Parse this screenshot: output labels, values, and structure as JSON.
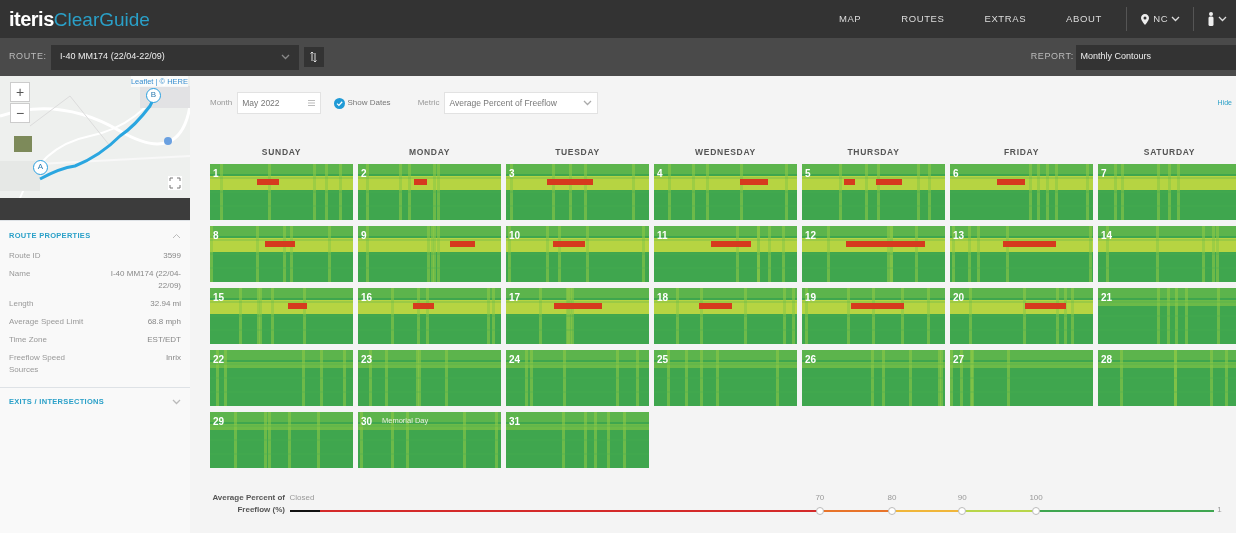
{
  "logo": {
    "brand": "iteris",
    "product": "ClearGuide"
  },
  "nav": {
    "items": [
      "MAP",
      "ROUTES",
      "EXTRAS",
      "ABOUT"
    ],
    "region": "NC"
  },
  "toolbar": {
    "route_label": "ROUTE:",
    "route": "I-40 MM174 (22/04-22/09)",
    "report_label": "REPORT:",
    "report": "Monthly Contours"
  },
  "map": {
    "attribution": "Leaflet | © HERE",
    "zoom_in": "+",
    "zoom_out": "−",
    "markers": [
      "A",
      "B"
    ]
  },
  "sections": [
    {
      "title": "ROUTE PROPERTIES",
      "expanded": true,
      "rows": [
        {
          "label": "Route ID",
          "value": "3599"
        },
        {
          "label": "Name",
          "value": "I-40 MM174 (22/04-22/09)"
        },
        {
          "label": "Length",
          "value": "32.94 mi"
        },
        {
          "label": "Average Speed Limit",
          "value": "68.8 mph"
        },
        {
          "label": "Time Zone",
          "value": "EST/EDT"
        },
        {
          "label": "Freeflow Speed Sources",
          "value": "Inrix"
        }
      ]
    },
    {
      "title": "EXITS / INTERSECTIONS",
      "expanded": false
    }
  ],
  "controls": {
    "month_label": "Month",
    "month": "May 2022",
    "show_dates_label": "Show Dates",
    "show_dates": true,
    "metric_label": "Metric",
    "metric": "Average Percent of Freeflow",
    "hide": "Hide"
  },
  "weekdays": [
    "SUNDAY",
    "MONDAY",
    "TUESDAY",
    "WEDNESDAY",
    "THURSDAY",
    "FRIDAY",
    "SATURDAY"
  ],
  "days": [
    {
      "label": "1"
    },
    {
      "label": "2"
    },
    {
      "label": "3"
    },
    {
      "label": "4"
    },
    {
      "label": "5"
    },
    {
      "label": "6"
    },
    {
      "label": "7"
    },
    {
      "label": "8"
    },
    {
      "label": "9"
    },
    {
      "label": "10"
    },
    {
      "label": "11"
    },
    {
      "label": "12"
    },
    {
      "label": "13"
    },
    {
      "label": "14"
    },
    {
      "label": "15"
    },
    {
      "label": "16"
    },
    {
      "label": "17"
    },
    {
      "label": "18"
    },
    {
      "label": "19"
    },
    {
      "label": "20"
    },
    {
      "label": "21"
    },
    {
      "label": "22"
    },
    {
      "label": "23"
    },
    {
      "label": "24"
    },
    {
      "label": "25"
    },
    {
      "label": "26"
    },
    {
      "label": "27"
    },
    {
      "label": "28"
    },
    {
      "label": "29"
    },
    {
      "label": "30",
      "note": "Memorial Day"
    },
    {
      "label": "31"
    }
  ],
  "legend": {
    "title": "Average Percent of Freeflow (%)",
    "start_label": "Closed",
    "end_label": "1",
    "segments": [
      {
        "color": "#111111"
      },
      {
        "color": "#d42a2a"
      },
      {
        "color": "#e8742a"
      },
      {
        "color": "#f0b63a"
      },
      {
        "color": "#b8d64a"
      },
      {
        "color": "#3fa650"
      }
    ],
    "stops": [
      {
        "label": "70",
        "level": 0.574
      },
      {
        "label": "80",
        "level": 0.652
      },
      {
        "label": "90",
        "level": 0.728
      },
      {
        "label": "100",
        "level": 0.808
      }
    ]
  }
}
